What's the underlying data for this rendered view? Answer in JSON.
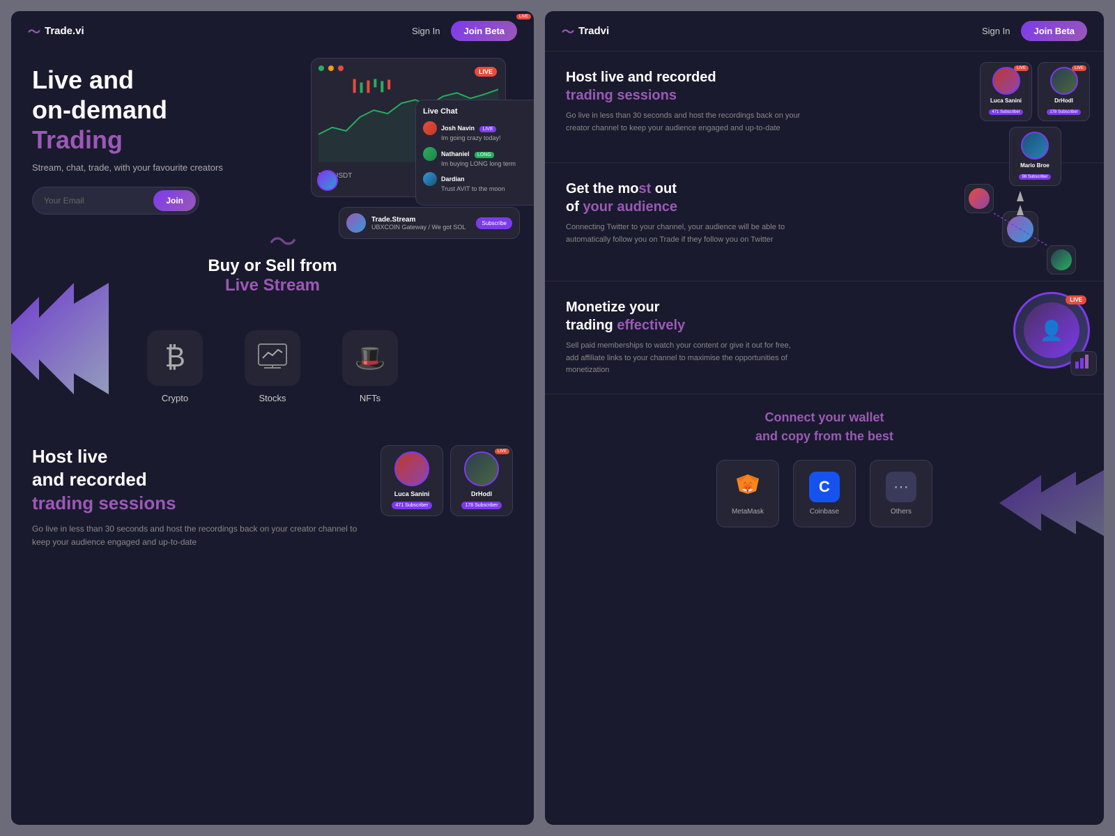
{
  "brand": {
    "name": "Trade.vi",
    "secondary_name": "Tradvi"
  },
  "navbar": {
    "sign_in": "Sign In",
    "join_beta": "Join Beta"
  },
  "hero": {
    "title_line1": "Live and",
    "title_line2": "on-demand",
    "title_purple": "Trading",
    "subtitle": "Stream, chat, trade, with your favourite creators",
    "email_placeholder": "Your Email",
    "join_button": "Join"
  },
  "buy_sell": {
    "title_white": "Buy or Sell from",
    "title_purple": "Live Stream"
  },
  "assets": [
    {
      "label": "Crypto",
      "icon": "₿"
    },
    {
      "label": "Stocks",
      "icon": "📊"
    },
    {
      "label": "NFTs",
      "icon": "🎩"
    }
  ],
  "host_section": {
    "title_line1": "Host live",
    "title_line2": "and recorded",
    "title_purple": "trading sessions",
    "desc": "Go live in less than 30 seconds and host the recordings back on your creator channel to keep your audience engaged and up-to-date",
    "profiles": [
      {
        "name": "Luca Sanini",
        "badge": "471 Subscriber"
      },
      {
        "name": "DrHodl",
        "badge": "178 Subscriber"
      }
    ]
  },
  "audience_section": {
    "title_line1": "Get the most out",
    "title_line2": "of ",
    "title_purple": "your audience",
    "desc": "Connecting Twitter to your channel, your audience will be able to automatically follow you on Trade if they follow you on Twitter"
  },
  "monetize_section": {
    "title_line1": "Monetize your",
    "title_line2": "trading ",
    "title_purple": "effectively",
    "desc": "Sell paid memberships to watch your content or give it out for free, add affiliate links to your channel to maximise the opportunities of monetization",
    "live_badge": "LIVE"
  },
  "wallet_section": {
    "title": "Connect your wallet\nand copy from the best",
    "wallets": [
      {
        "name": "MetaMask",
        "color": "#f6851b"
      },
      {
        "name": "Coinbase",
        "color": "#1652f0"
      },
      {
        "name": "Others",
        "color": "#555"
      }
    ]
  },
  "chart": {
    "pair": "FTT/USDT",
    "live": "LIVE"
  },
  "chat": {
    "title": "Live Chat",
    "messages": [
      {
        "name": "Josh Navin",
        "badge": "LIVE",
        "text": "Im going crazy today!"
      },
      {
        "name": "Nathaniel",
        "badge": "LONG",
        "text": "Im buying LONG long term"
      },
      {
        "name": "Dardian",
        "text": "Trust AVIT to the moon"
      }
    ]
  }
}
